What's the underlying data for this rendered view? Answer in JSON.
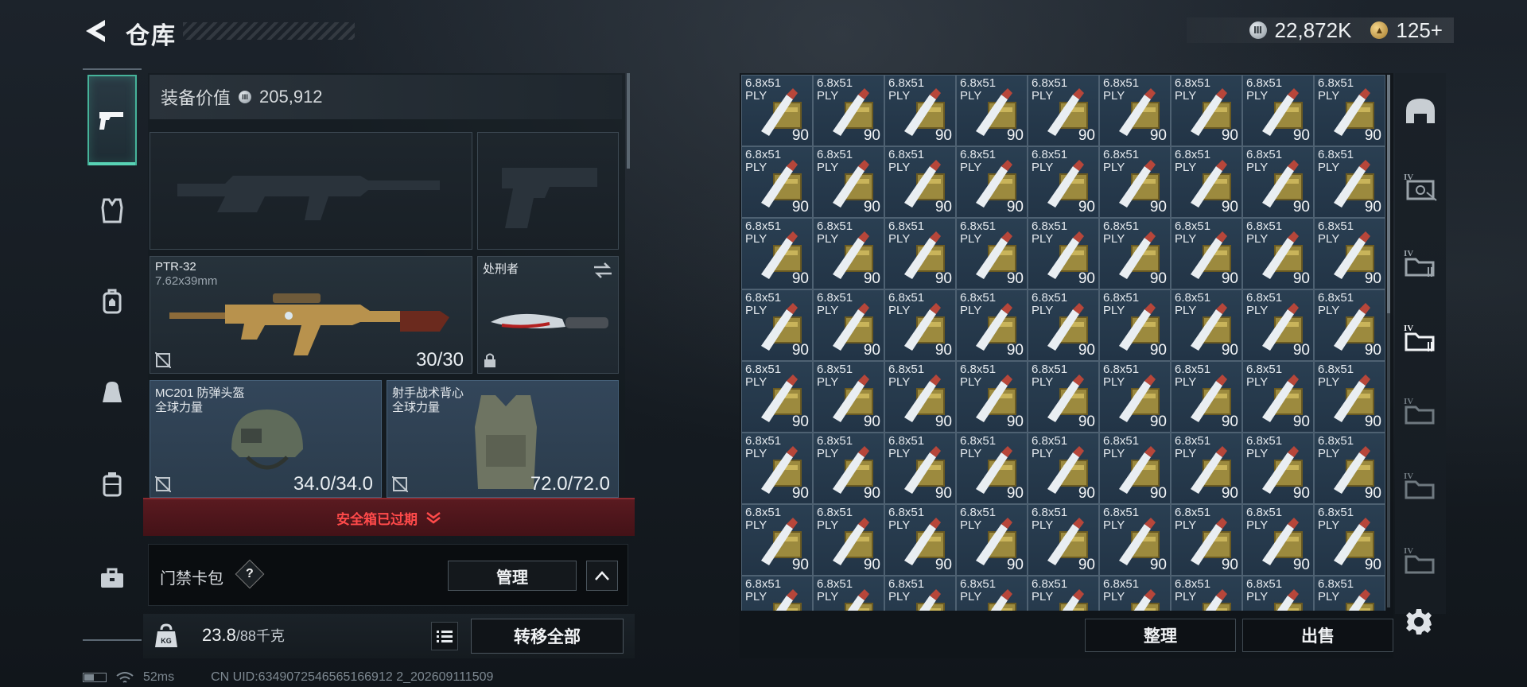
{
  "header": {
    "title": "仓库",
    "currencies": [
      {
        "icon": "silver-coin-icon",
        "value": "22,872K"
      },
      {
        "icon": "gold-coin-icon",
        "value": "125+"
      }
    ]
  },
  "nav": {
    "items": [
      {
        "name": "weapons",
        "icon": "pistol-icon",
        "active": true
      },
      {
        "name": "armor",
        "icon": "vest-icon"
      },
      {
        "name": "backpack",
        "icon": "backpack-icon"
      },
      {
        "name": "bag",
        "icon": "bag-icon"
      },
      {
        "name": "container",
        "icon": "canister-icon"
      },
      {
        "name": "toolbox",
        "icon": "toolbox-icon"
      }
    ]
  },
  "loadout": {
    "equip_value_label": "装备价值",
    "equip_value": "205,912",
    "primary_weapon": {
      "name": "PTR-32",
      "caliber": "7.62x39mm",
      "ammo": "30/30"
    },
    "melee": {
      "name": "处刑者"
    },
    "helmet": {
      "name": "MC201 防弹头盔",
      "brand": "全球力量",
      "durability": "34.0/34.0"
    },
    "vest": {
      "name": "射手战术背心",
      "brand": "全球力量",
      "durability": "72.0/72.0"
    },
    "safe_box_notice": "安全箱已过期",
    "keycard": {
      "label": "门禁卡包",
      "help": "?",
      "manage": "管理"
    },
    "weight": {
      "current": "23.8",
      "max": "/88千克"
    },
    "transfer_all": "转移全部"
  },
  "status": {
    "ping": "52ms",
    "uid": "CN UID:6349072546565166912 2_202609111509"
  },
  "storage": {
    "item": {
      "caliber": "6.8x51",
      "brand": "PLY",
      "qty": "90"
    },
    "rows_full": 7,
    "cols": 9,
    "sort_label": "整理",
    "sell_label": "出售"
  },
  "right_rail": {
    "items": [
      "helmet-slot-icon",
      "safe-box-iv-icon",
      "storage-iv-icon",
      "storage-iv-active-icon",
      "storage-iv-icon",
      "storage-iv-icon",
      "storage-iv-icon"
    ]
  },
  "colors": {
    "accent": "#46b39a",
    "warning": "#ff4a4a",
    "cell_bg": "#2a3f52"
  }
}
